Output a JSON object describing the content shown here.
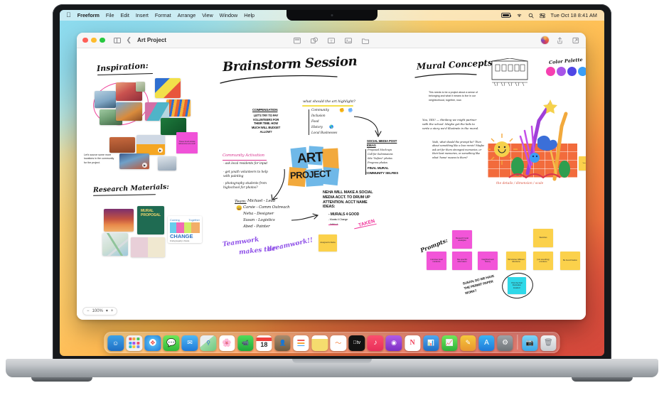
{
  "menubar": {
    "apple_icon": "apple-logo-icon",
    "items": [
      "Freeform",
      "File",
      "Edit",
      "Insert",
      "Format",
      "Arrange",
      "View",
      "Window",
      "Help"
    ],
    "status_icons": [
      "battery-icon",
      "wifi-icon",
      "search-icon",
      "control-center-icon"
    ],
    "clock": "Tue Oct 18  8:41 AM"
  },
  "window": {
    "title": "Art Project",
    "traffic_lights": [
      "close-button",
      "minimize-button",
      "zoom-button"
    ],
    "sidebar_toggle": "sidebar-toggle-icon",
    "back_button": "back-chevron-icon",
    "toolbar_center": [
      "sticky-note-icon",
      "shapes-icon",
      "text-box-icon",
      "media-icon",
      "insert-file-icon"
    ],
    "toolbar_right": [
      "avatar-icon",
      "share-icon",
      "collaborate-icon"
    ],
    "zoom": {
      "minus": "−",
      "level": "100%",
      "chevron": "▾",
      "plus": "+"
    }
  },
  "canvas": {
    "sections": {
      "inspiration": {
        "heading": "Inspiration:",
        "note_magenta": "These brush stroke references are cool!",
        "caption": "Let's source some more locations in the community for the project."
      },
      "brainstorm": {
        "heading": "Brainstorm Session",
        "compensation_title": "COMPENSATION",
        "compensation_body": "LET'S TRY TO PAY VOLUNTEERS FOR THEIR TIME. HOW MUCH WILL BUDGET ALLOW?",
        "highlight_question": "what should the art highlight?",
        "highlight_list": [
          "Community",
          "Inclusion",
          "Food",
          "History",
          "Local Businesses"
        ],
        "social_title": "SOCIAL MEDIA POST IDEAS",
        "social_list": [
          "Proposed Mock-ups",
          "Call for Submissions",
          "Site \"before\" photos",
          "Progress photos",
          "FINAL MURAL",
          "COMMUNITY SELFIES"
        ],
        "community_title": "Community Activation",
        "community_list": [
          "- ask local residents for input",
          "- get youth volunteers to help with painting",
          "- photography students from highschool for photos?"
        ],
        "team_title": "Team:",
        "team_list": [
          "Michael - Lead",
          "Carsie - Comm Outreach",
          "Neha - Designer",
          "Susan - Logistics",
          "Abed - Painter"
        ],
        "logo_text_1": "ART",
        "logo_text_2": "PROJECT",
        "neha_note": "NEHA WILL MAKE A SOCIAL MEDIA ACCT. TO DRUM UP ATTENTION. ACCT NAME IDEAS:",
        "acct_ideas": [
          "- MURALS 4 GOOD",
          "- Murals 4 Change",
          "- Artblock"
        ],
        "taken_stamp": "TAKEN",
        "yellow_note": "Assigned to Neha",
        "teamwork_1": "Teamwork",
        "teamwork_2": "makes the",
        "teamwork_3": "dreamwork!!"
      },
      "mural_concepts": {
        "heading": "Mural Concepts",
        "palette_heading": "Color Palette",
        "palette_colors": [
          "#f63fb0",
          "#a855e8",
          "#4f46e5",
          "#3b9ef5"
        ],
        "statement": "This needs to be a project about a sense of belonging and what it means to live in our neighborhood, together, now.",
        "annotation_1": "You, YES! — thinking we might partner with the school. Maybe get the kids to write a story we'd illustrate in the mural.",
        "annotation_2": "Yeah, what should the prompt be? Then about something like a love remix? Maybe ask art for them strongest memories, or their best memories, or something like what 'home' means to them?",
        "caption_orange": "the details / dimension / scale"
      },
      "prompts": {
        "heading": "Prompts:",
        "notes_row_top": [
          "Research local analogies",
          "Sketches"
        ],
        "notes_row_main": [
          "Interview local residents",
          "Site specific information",
          "Neighborhood history",
          "Tell stories/ different directions",
          "[not sounding] emotions",
          "Be found fixation"
        ],
        "cyan_note": "Pick the final illustration location!",
        "handwritten_question": "SUSAN, DO WE HAVE THE PERMIT PAPER WORK?"
      },
      "research": {
        "heading": "Research Materials:",
        "doc_1_title": "MURAL PROPOSAL",
        "doc_2_line1": "Coming",
        "doc_2_line2": "Together",
        "doc_2_line3": "for",
        "doc_2_big": "CHANGE",
        "doc_2_sub": "Finding Equality in Murals"
      }
    }
  },
  "dock": {
    "apps": [
      {
        "name": "finder-icon",
        "label": "Finder",
        "running": true
      },
      {
        "name": "launchpad-icon",
        "label": "Launchpad",
        "running": false
      },
      {
        "name": "safari-icon",
        "label": "Safari",
        "running": false
      },
      {
        "name": "messages-icon",
        "label": "Messages",
        "running": false
      },
      {
        "name": "mail-icon",
        "label": "Mail",
        "running": false
      },
      {
        "name": "maps-icon",
        "label": "Maps",
        "running": false
      },
      {
        "name": "photos-icon",
        "label": "Photos",
        "running": false
      },
      {
        "name": "facetime-icon",
        "label": "FaceTime",
        "running": false
      },
      {
        "name": "calendar-icon",
        "label": "18",
        "running": false
      },
      {
        "name": "contacts-icon",
        "label": "Contacts",
        "running": false
      },
      {
        "name": "reminders-icon",
        "label": "Reminders",
        "running": false
      },
      {
        "name": "notes-icon",
        "label": "Notes",
        "running": false
      },
      {
        "name": "freeform-icon",
        "label": "Freeform",
        "running": true
      },
      {
        "name": "appletv-icon",
        "label": "Apple TV",
        "running": false
      },
      {
        "name": "music-icon",
        "label": "Music",
        "running": false
      },
      {
        "name": "podcasts-icon",
        "label": "Podcasts",
        "running": false
      },
      {
        "name": "news-icon",
        "label": "News",
        "running": false
      },
      {
        "name": "keynote-icon",
        "label": "Keynote",
        "running": false
      },
      {
        "name": "numbers-icon",
        "label": "Numbers",
        "running": false
      },
      {
        "name": "pages-icon",
        "label": "Pages",
        "running": false
      },
      {
        "name": "appstore-icon",
        "label": "App Store",
        "running": false
      },
      {
        "name": "settings-icon",
        "label": "System Settings",
        "running": false
      }
    ],
    "downloads": "downloads-folder-icon",
    "trash": "trash-icon"
  }
}
